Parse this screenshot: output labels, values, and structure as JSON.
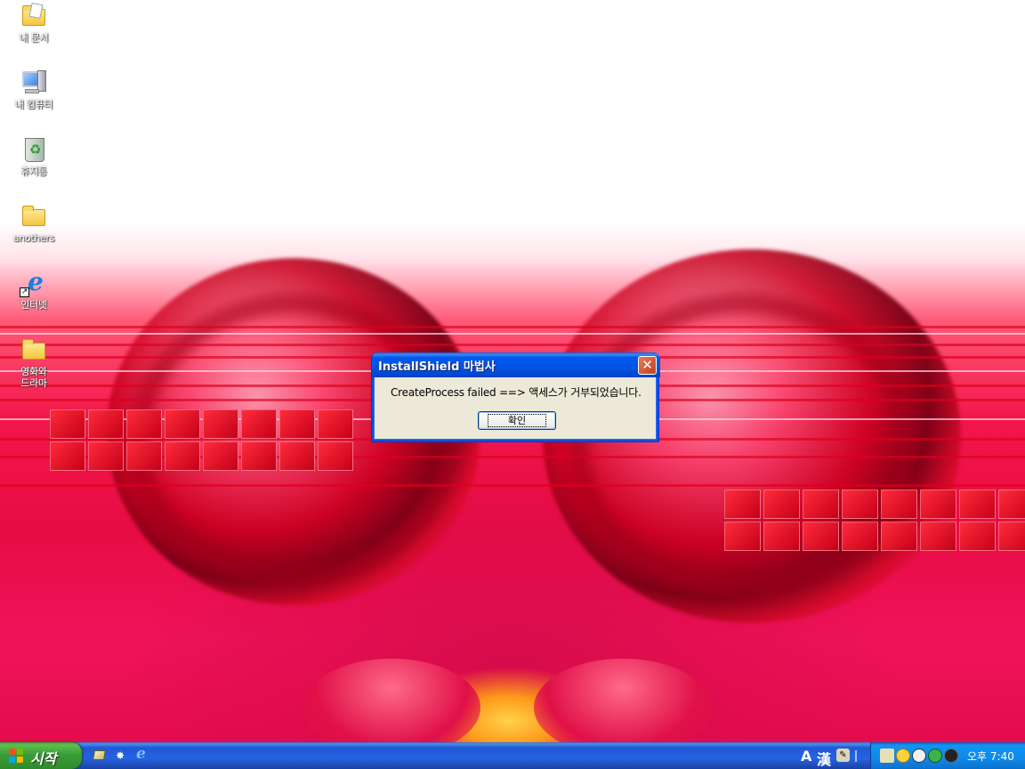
{
  "desktop": {
    "icons": [
      {
        "label": "내 문서",
        "icon": "my-documents-icon"
      },
      {
        "label": "내 컴퓨터",
        "icon": "my-computer-icon"
      },
      {
        "label": "휴지통",
        "icon": "recycle-bin-icon"
      },
      {
        "label": "anothers",
        "icon": "folder-icon"
      },
      {
        "label": "인터넷",
        "icon": "internet-explorer-icon"
      },
      {
        "label": "영화와\n드라마",
        "icon": "folder-icon"
      }
    ]
  },
  "dialog": {
    "title": "InstallShield 마법사",
    "message": "CreateProcess failed  ==>  액세스가 거부되었습니다.",
    "ok_label": "확인",
    "close_glyph": "✕"
  },
  "taskbar": {
    "start_label": "시작",
    "ime": {
      "mode_letter": "A",
      "hanja": "漢"
    },
    "clock": "오후 7:40"
  },
  "colors": {
    "titlebar": "#0054e3",
    "taskbar": "#2663e0",
    "start": "#3a9d37",
    "tray": "#0f8ae8",
    "dialog_face": "#ece9d8"
  }
}
